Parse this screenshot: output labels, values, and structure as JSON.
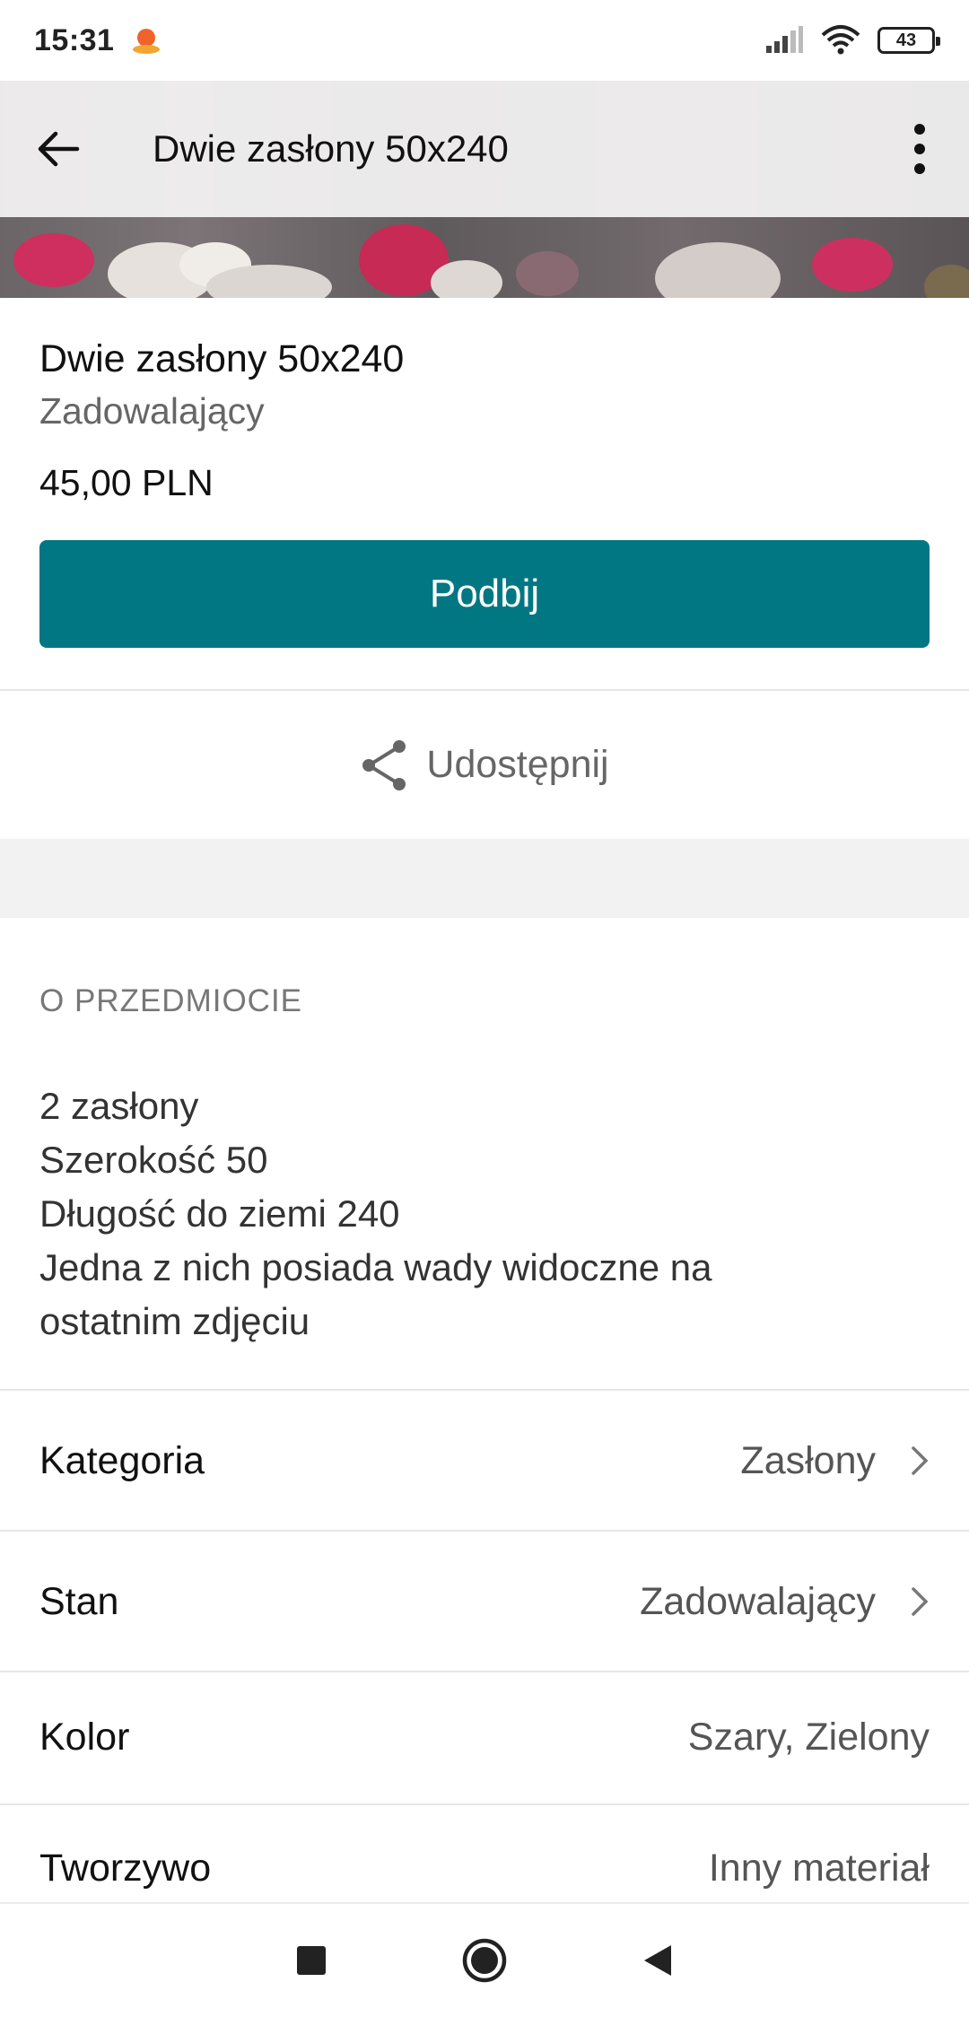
{
  "status_bar": {
    "time": "15:31",
    "battery": "43",
    "icons": [
      "notification-app-icon",
      "signal-icon",
      "wifi-icon",
      "battery-icon"
    ]
  },
  "top_bar": {
    "title": "Dwie zasłony 50x240",
    "back_icon": "arrow-left-icon",
    "more_icon": "more-vertical-icon"
  },
  "item": {
    "title": "Dwie zasłony 50x240",
    "condition": "Zadowalający",
    "price": "45,00 PLN",
    "bump_label": "Podbij",
    "share_label": "Udostępnij"
  },
  "about": {
    "heading": "O PRZEDMIOCIE",
    "description_lines": [
      "2 zasłony",
      "Szerokość 50",
      "Długość do ziemi 240",
      "Jedna z nich posiada wady widoczne na",
      "ostatnim zdjęciu"
    ]
  },
  "attributes": [
    {
      "label": "Kategoria",
      "value": "Zasłony"
    },
    {
      "label": "Stan",
      "value": "Zadowalający"
    },
    {
      "label": "Kolor",
      "value": "Szary, Zielony"
    },
    {
      "label": "Tworzywo",
      "value": "Inny materiał"
    }
  ],
  "colors": {
    "accent": "#007782",
    "muted_text": "#666666",
    "divider": "#e6e6e6"
  },
  "nav_bar": {
    "icons": [
      "recent-apps-icon",
      "home-icon",
      "back-triangle-icon"
    ]
  }
}
